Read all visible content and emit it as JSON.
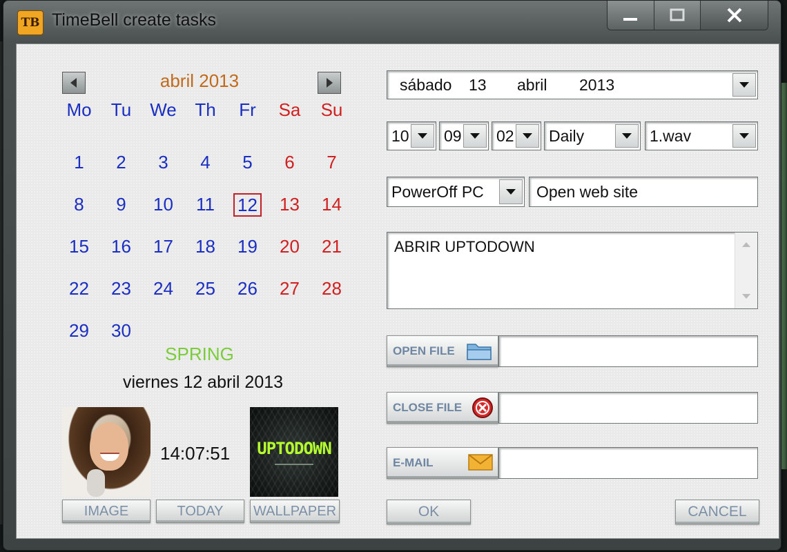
{
  "window": {
    "app_icon_text": "TB",
    "title": "TimeBell create tasks",
    "controls": {
      "minimize": "—",
      "maximize": "□",
      "close": "✕"
    }
  },
  "calendar": {
    "month_title": "abril 2013",
    "prev_icon": "left-arrow-icon",
    "next_icon": "right-arrow-icon",
    "weekdays": [
      "Mo",
      "Tu",
      "We",
      "Th",
      "Fr",
      "Sa",
      "Su"
    ],
    "weeks": [
      [
        "1",
        "2",
        "3",
        "4",
        "5",
        "6",
        "7"
      ],
      [
        "8",
        "9",
        "10",
        "11",
        "12",
        "13",
        "14"
      ],
      [
        "15",
        "16",
        "17",
        "18",
        "19",
        "20",
        "21"
      ],
      [
        "22",
        "23",
        "24",
        "25",
        "26",
        "27",
        "28"
      ],
      [
        "29",
        "30",
        "",
        "",
        "",
        "",
        ""
      ]
    ],
    "selected_day": "12",
    "colors": {
      "weekday": "#1a2ec2",
      "weekend": "#d02020",
      "month": "#c26a1c",
      "selected_border": "#c0202a"
    }
  },
  "season": "SPRING",
  "season_color": "#7acc3a",
  "current_date": "viernes 12 abril 2013",
  "clock": "14:07:51",
  "wallpaper_logo": "UPTODOWN",
  "left_buttons": {
    "image": "IMAGE",
    "today": "TODAY",
    "wallpaper": "WALLPAPER"
  },
  "form": {
    "date_combo": {
      "day_name": "sábado",
      "day": "13",
      "month": "abril",
      "year": "2013"
    },
    "hour": "10",
    "minute": "09",
    "second": "02",
    "repeat": "Daily",
    "sound": "1.wav",
    "action": "PowerOff PC",
    "action_target": "Open web site",
    "message": "ABRIR UPTODOWN",
    "open_file_label": "OPEN FILE",
    "open_file_value": "",
    "close_file_label": "CLOSE FILE",
    "close_file_value": "",
    "email_label": "E-MAIL",
    "email_value": "",
    "ok": "OK",
    "cancel": "CANCEL"
  }
}
